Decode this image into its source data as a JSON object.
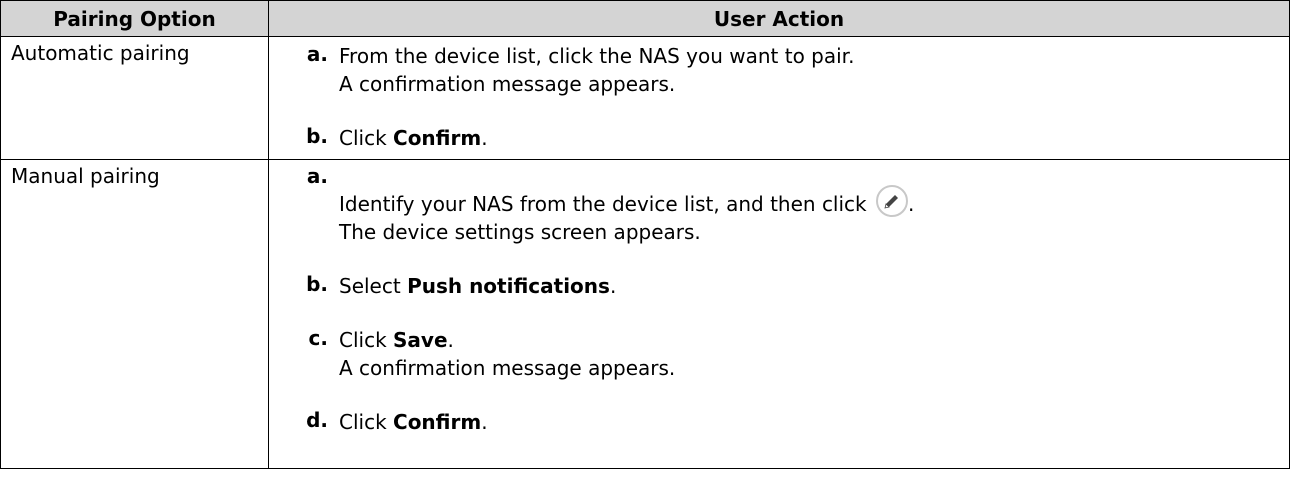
{
  "table": {
    "headers": {
      "option": "Pairing Option",
      "action": "User Action"
    },
    "rows": [
      {
        "option": "Automatic pairing",
        "steps": [
          {
            "letter": "a.",
            "line1": "From the device list, click the NAS you want to pair.",
            "line2": "A confirmation message appears."
          },
          {
            "letter": "b.",
            "prefix": "Click ",
            "keyword": "Confirm",
            "suffix": "."
          }
        ]
      },
      {
        "option": "Manual pairing",
        "steps": [
          {
            "letter": "a.",
            "line1": "Identify your NAS from the device list, and then click",
            "line1_end": ".",
            "icon": "edit-pencil-icon",
            "line2": "The device settings screen appears."
          },
          {
            "letter": "b.",
            "prefix": "Select ",
            "keyword": "Push notifications",
            "suffix": "."
          },
          {
            "letter": "c.",
            "prefix": "Click ",
            "keyword": "Save",
            "suffix": ".",
            "line2": "A confirmation message appears."
          },
          {
            "letter": "d.",
            "prefix": "Click ",
            "keyword": "Confirm",
            "suffix": "."
          }
        ]
      }
    ]
  },
  "colors": {
    "header_bg": "#d4d4d4",
    "border": "#000000",
    "icon_ring": "#c8c8c8",
    "icon_pen": "#444444"
  }
}
